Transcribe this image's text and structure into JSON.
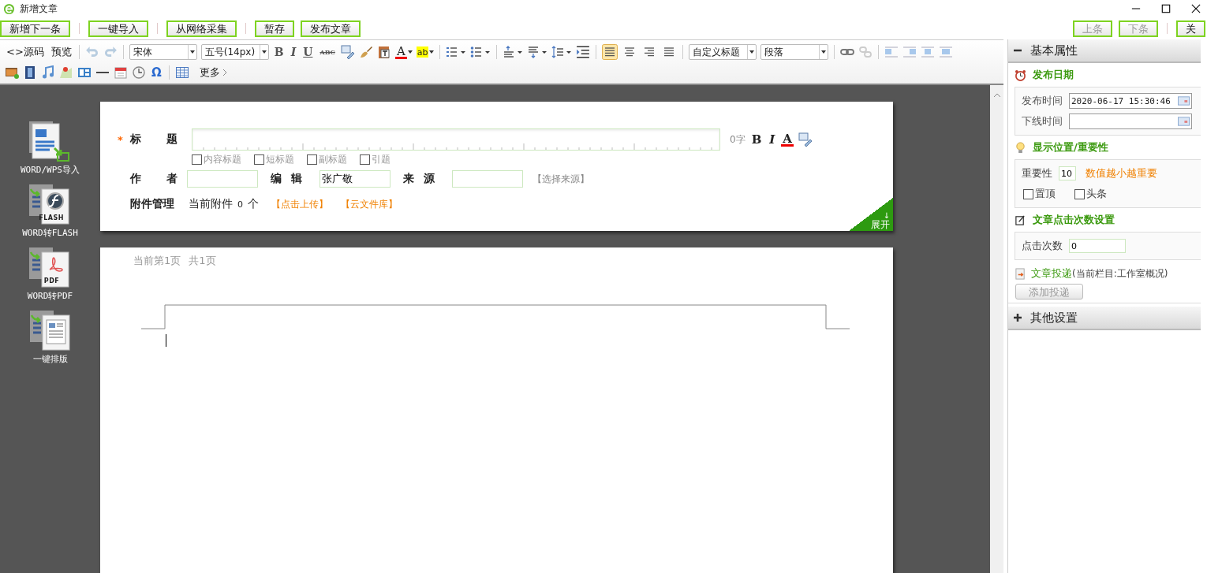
{
  "window": {
    "title": "新增文章"
  },
  "action_groups": [
    [
      "新增下一条"
    ],
    [
      "一键导入"
    ],
    [
      "从网络采集"
    ],
    [
      "暂存",
      "发布文章"
    ]
  ],
  "nav_groups": [
    [
      {
        "label": "上条",
        "disabled": true
      },
      {
        "label": "下条",
        "disabled": true
      }
    ],
    [
      {
        "label": "关",
        "disabled": false
      }
    ]
  ],
  "editor_toolbar": {
    "source": "<>源码",
    "preview": "预览",
    "font": "宋体",
    "size": "五号(14px)",
    "format": [
      "B",
      "I",
      "U",
      "ABC"
    ],
    "font_color": "A",
    "highlight": "ab",
    "align": [
      {
        "selected": true
      },
      {
        "selected": false
      },
      {
        "selected": false
      },
      {
        "selected": false
      }
    ],
    "heading": "自定义标题",
    "paragraph": "段落",
    "special_char": "Ω",
    "more": "更多"
  },
  "import_tools": [
    {
      "kind": "word",
      "label": "WORD/WPS导入"
    },
    {
      "kind": "flash",
      "label": "WORD转FLASH",
      "badge": "FLASH"
    },
    {
      "kind": "pdf",
      "label": "WORD转PDF",
      "badge": "PDF"
    },
    {
      "kind": "layout",
      "label": "一键排版"
    }
  ],
  "article_form": {
    "required_mark": "*",
    "title_label": "标题",
    "title_count": "0字",
    "title_styles": [
      "B",
      "I",
      "A"
    ],
    "subtitle_options": [
      {
        "label": "内容标题",
        "checked": false
      },
      {
        "label": "短标题",
        "checked": false
      },
      {
        "label": "副标题",
        "checked": false
      },
      {
        "label": "引题",
        "checked": false
      }
    ],
    "author_label": "作者",
    "editor_label": "编辑",
    "editor_value": "张广敬",
    "source_label": "来源",
    "source_picker": "【选择来源】",
    "attachments_label": "附件管理",
    "attachments_text": "当前附件",
    "attachments_count": "0",
    "attachments_unit": "个",
    "upload_link": "【点击上传】",
    "cloud_link": "【云文件库】",
    "expand_arrow": "↓",
    "expand_label": "展开"
  },
  "page_info": {
    "current": "当前第1页",
    "total": "共1页"
  },
  "panels": [
    {
      "title": "基本属性",
      "expanded": true
    },
    {
      "title": "其他设置",
      "expanded": false
    }
  ],
  "publish_date": {
    "heading": "发布日期",
    "publish_label": "发布时间",
    "publish_value": "2020-06-17 15:30:46",
    "offline_label": "下线时间"
  },
  "display": {
    "heading": "显示位置/重要性",
    "importance_label": "重要性",
    "importance_value": "10",
    "importance_hint": "数值越小越重要",
    "flags": [
      {
        "label": "置顶",
        "checked": false
      },
      {
        "label": "头条",
        "checked": false
      }
    ]
  },
  "clicks": {
    "heading": "文章点击次数设置",
    "label": "点击次数",
    "value": "0"
  },
  "delivery": {
    "link": "文章投递",
    "note": "(当前栏目:工作室概况)",
    "button": "添加投递"
  }
}
